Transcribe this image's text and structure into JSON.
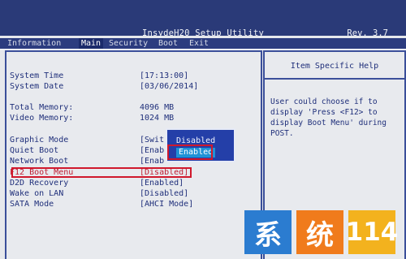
{
  "header": {
    "title": "InsydeH20 Setup Utility",
    "rev": "Rev. 3.7"
  },
  "tabs": [
    {
      "label": "Information",
      "active": false
    },
    {
      "label": "Main",
      "active": true
    },
    {
      "label": "Security",
      "active": false
    },
    {
      "label": "Boot",
      "active": false
    },
    {
      "label": "Exit",
      "active": false
    }
  ],
  "settings": {
    "system_time": {
      "label": "System Time",
      "value": "[17:13:00]"
    },
    "system_date": {
      "label": "System Date",
      "value": "[03/06/2014]"
    },
    "total_memory": {
      "label": "Total Memory:",
      "value": "4096 MB"
    },
    "video_memory": {
      "label": "Video Memory:",
      "value": "1024 MB"
    },
    "graphic_mode": {
      "label": "Graphic Mode",
      "value": "[Swit"
    },
    "quiet_boot": {
      "label": "Quiet Boot",
      "value": "[Enab"
    },
    "network_boot": {
      "label": "Network Boot",
      "value": "[Enab"
    },
    "f12_boot_menu": {
      "label": "F12 Boot Menu",
      "value": "[Disabled]"
    },
    "d2d_recovery": {
      "label": "D2D Recovery",
      "value": "[Enabled]"
    },
    "wake_on_lan": {
      "label": "Wake on LAN",
      "value": "[Disabled]"
    },
    "sata_mode": {
      "label": "SATA Mode",
      "value": "[AHCI Mode]"
    }
  },
  "popup": {
    "option_disabled": "Disabled",
    "option_enabled": "Enabled",
    "selected": "Enabled"
  },
  "help": {
    "title": "Item Specific Help",
    "lines": [
      "User could choose if to",
      "display 'Press <F12> to",
      "display Boot Menu' during",
      "POST."
    ]
  },
  "watermark": {
    "chars": [
      "系",
      "统",
      "114"
    ]
  },
  "colors": {
    "title_bar": "#2a3a78",
    "panel_text": "#1f2f7a",
    "highlight_red": "#d0182c",
    "popup_bg": "#243fa8",
    "popup_selected": "#1f92d6"
  }
}
